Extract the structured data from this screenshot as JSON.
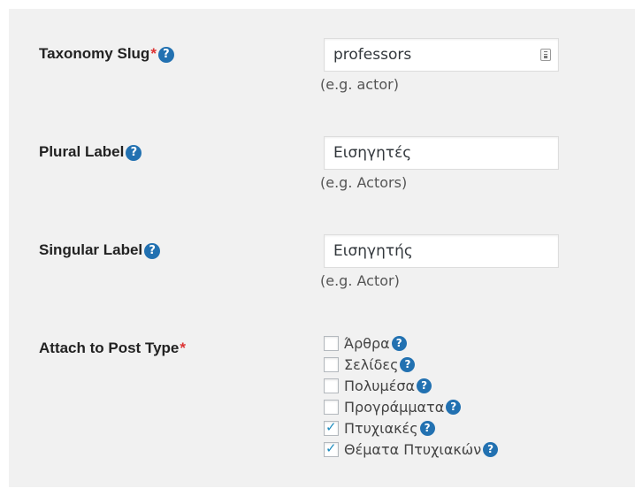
{
  "fields": {
    "taxonomy_slug": {
      "label": "Taxonomy Slug",
      "required_mark": "*",
      "value": "professors",
      "hint": "(e.g. actor)"
    },
    "plural_label": {
      "label": "Plural Label",
      "value": "Εισηγητές",
      "hint": "(e.g. Actors)"
    },
    "singular_label": {
      "label": "Singular Label",
      "value": "Εισηγητής",
      "hint": "(e.g. Actor)"
    },
    "attach_post_type": {
      "label": "Attach to Post Type",
      "required_mark": "*",
      "options": [
        {
          "label": "Άρθρα",
          "checked": false
        },
        {
          "label": "Σελίδες",
          "checked": false
        },
        {
          "label": "Πολυμέσα",
          "checked": false
        },
        {
          "label": "Προγράμματα",
          "checked": false
        },
        {
          "label": "Πτυχιακές",
          "checked": true
        },
        {
          "label": "Θέματα Πτυχιακών",
          "checked": true
        }
      ]
    }
  },
  "help_glyph": "?",
  "colors": {
    "panel_bg": "#f1f1f1",
    "required": "#dc3232",
    "help_icon": "#2271b1",
    "checkmark": "#1e8cbe"
  },
  "icons": {
    "help": "help-circle-icon",
    "input_addon": "contact-card-icon"
  }
}
